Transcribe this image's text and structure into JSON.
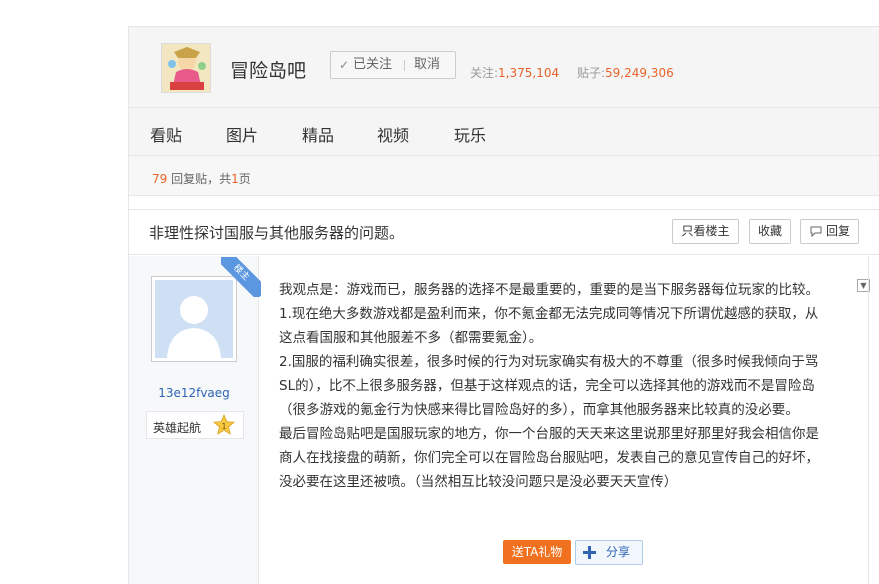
{
  "header": {
    "forum_title": "冒险岛吧",
    "follow_check": "✓",
    "followed_label": "已关注",
    "cancel_label": "取消",
    "stats_follow_label": "关注:",
    "stats_follow_value": "1,375,104",
    "stats_posts_label": "贴子:",
    "stats_posts_value": "59,249,306"
  },
  "nav": {
    "items": [
      "看贴",
      "图片",
      "精品",
      "视频",
      "玩乐"
    ]
  },
  "pager": {
    "reply_count": "79",
    "reply_label": "回复贴，共",
    "page_count": "1",
    "page_label": "页"
  },
  "thread": {
    "title": "非理性探讨国服与其他服务器的问题。",
    "only_op_label": "只看楼主",
    "favorite_label": "收藏",
    "reply_label": "回复"
  },
  "post": {
    "badge": "楼主",
    "username": "13e12fvaeg",
    "rank": "英雄起航",
    "rank_level": "1",
    "lines": [
      "我观点是：游戏而已，服务器的选择不是最重要的，重要的是当下服务器每位玩家的比较。",
      "1.现在绝大多数游戏都是盈利而来，你不氪金都无法完成同等情况下所谓优越感的获取，从",
      "这点看国服和其他服差不多（都需要氪金）。",
      "2.国服的福利确实很差，很多时候的行为对玩家确实有极大的不尊重（很多时候我倾向于骂",
      "SL的），比不上很多服务器，但基于这样观点的话，完全可以选择其他的游戏而不是冒险岛",
      "（很多游戏的氪金行为快感来得比冒险岛好的多），而拿其他服务器来比较真的没必要。",
      "最后冒险岛贴吧是国服玩家的地方，你一个台服的天天来这里说那里好那里好我会相信你是",
      "商人在找接盘的萌新，你们完全可以在冒险岛台服贴吧，发表自己的意见宣传自己的好坏，",
      "没必要在这里还被喷。（当然相互比较没问题只是没必要天天宣传）"
    ],
    "gift_label": "送TA礼物",
    "share_label": "分享"
  }
}
